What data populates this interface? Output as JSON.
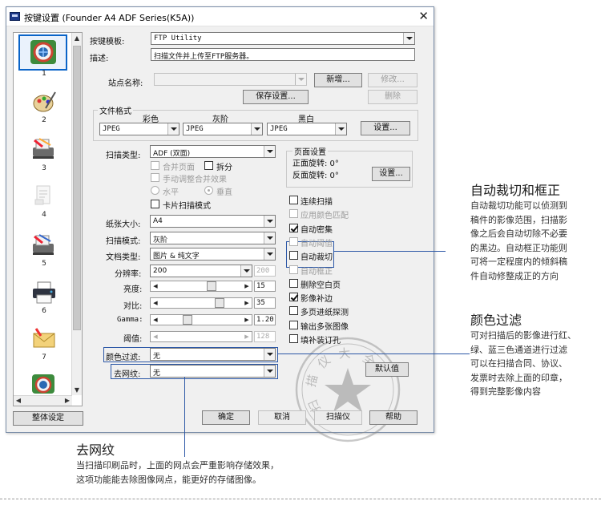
{
  "window": {
    "title": "按键设置 (Founder A4 ADF Series(K5A))"
  },
  "thumbnails": [
    "1",
    "2",
    "3",
    "4",
    "5",
    "6",
    "7"
  ],
  "form": {
    "button_template_label": "按键模板:",
    "button_template_value": "FTP Utility",
    "description_label": "描述:",
    "description_value": "扫描文件并上传至FTP服务器。",
    "site_name_label": "站点名称:",
    "new_button": "新增...",
    "modify_button": "修改...",
    "save_settings_button": "保存设置...",
    "delete_button": "删除",
    "file_format_group": "文件格式",
    "color_label": "彩色",
    "gray_label": "灰阶",
    "bw_label": "黑白",
    "color_value": "JPEG",
    "gray_value": "JPEG",
    "bw_value": "JPEG",
    "format_settings_button": "设置..."
  },
  "scan": {
    "scan_type_label": "扫描类型:",
    "scan_type_value": "ADF (双面)",
    "merge_pages": "合并页面",
    "split": "拆分",
    "manual_merge": "手动调整合并效果",
    "horizontal": "水平",
    "vertical": "垂直",
    "card_scan": "卡片扫描模式",
    "paper_size_label": "纸张大小:",
    "paper_size_value": "A4",
    "scan_mode_label": "扫描模式:",
    "scan_mode_value": "灰阶",
    "doc_type_label": "文档类型:",
    "doc_type_value": "图片 & 纯文字",
    "resolution_label": "分辨率:",
    "resolution_value": "200",
    "resolution_alt": "200",
    "brightness_label": "亮度:",
    "brightness_value": "15",
    "contrast_label": "对比:",
    "contrast_value": "35",
    "gamma_label": "Gamma:",
    "gamma_value": "1.20",
    "threshold_label": "阈值:",
    "threshold_value": "128",
    "color_filter_label": "颜色过滤:",
    "color_filter_value": "无",
    "descreen_label": "去网纹:",
    "descreen_value": "无"
  },
  "page_settings": {
    "group_title": "页面设置",
    "front_rotation": "正面旋转: 0°",
    "back_rotation": "反面旋转: 0°",
    "settings_button": "设置..."
  },
  "options": [
    {
      "label": "连续扫描",
      "checked": false,
      "disabled": false
    },
    {
      "label": "应用颜色匹配",
      "checked": false,
      "disabled": true
    },
    {
      "label": "自动密集",
      "checked": true,
      "disabled": false
    },
    {
      "label": "自动阈值",
      "checked": false,
      "disabled": true
    },
    {
      "label": "自动裁切",
      "checked": false,
      "disabled": false
    },
    {
      "label": "自动框正",
      "checked": false,
      "disabled": true
    },
    {
      "label": "删除空白页",
      "checked": false,
      "disabled": false
    },
    {
      "label": "影像补边",
      "checked": true,
      "disabled": false
    },
    {
      "label": "多页进纸探测",
      "checked": false,
      "disabled": false
    },
    {
      "label": "输出多张图像",
      "checked": false,
      "disabled": false
    },
    {
      "label": "填补装订孔",
      "checked": false,
      "disabled": false
    }
  ],
  "buttons": {
    "default": "默认值",
    "global_settings": "整体设定",
    "ok": "确定",
    "cancel": "取消",
    "scan": "扫描仪",
    "help": "帮助"
  },
  "stamp": {
    "text": "扫描仪大全"
  },
  "annotations": {
    "crop_title": "自动裁切和框正",
    "crop_body": [
      "自动裁切功能可以侦测到",
      "稿件的影像范围，扫描影",
      "像之后会自动切除不必要",
      "的黑边。自动框正功能则",
      "可将一定程度内的倾斜稿",
      "件自动修整成正的方向"
    ],
    "filter_title": "颜色过滤",
    "filter_body": [
      "可对扫描后的影像进行红、",
      "绿、蓝三色通道进行过滤",
      "可以在扫描合同、协议、",
      "发票时去除上面的印章，",
      "得到完整影像内容"
    ],
    "descreen_title": "去网纹",
    "descreen_body": [
      "当扫描印刷品时，上面的网点会严重影响存储效果，",
      "这项功能能去除图像网点，能更好的存储图像。"
    ]
  },
  "colors": {
    "accent": "#2b57a6",
    "dialog_bg": "#f0f0f0",
    "selection": "#0a64c8"
  }
}
